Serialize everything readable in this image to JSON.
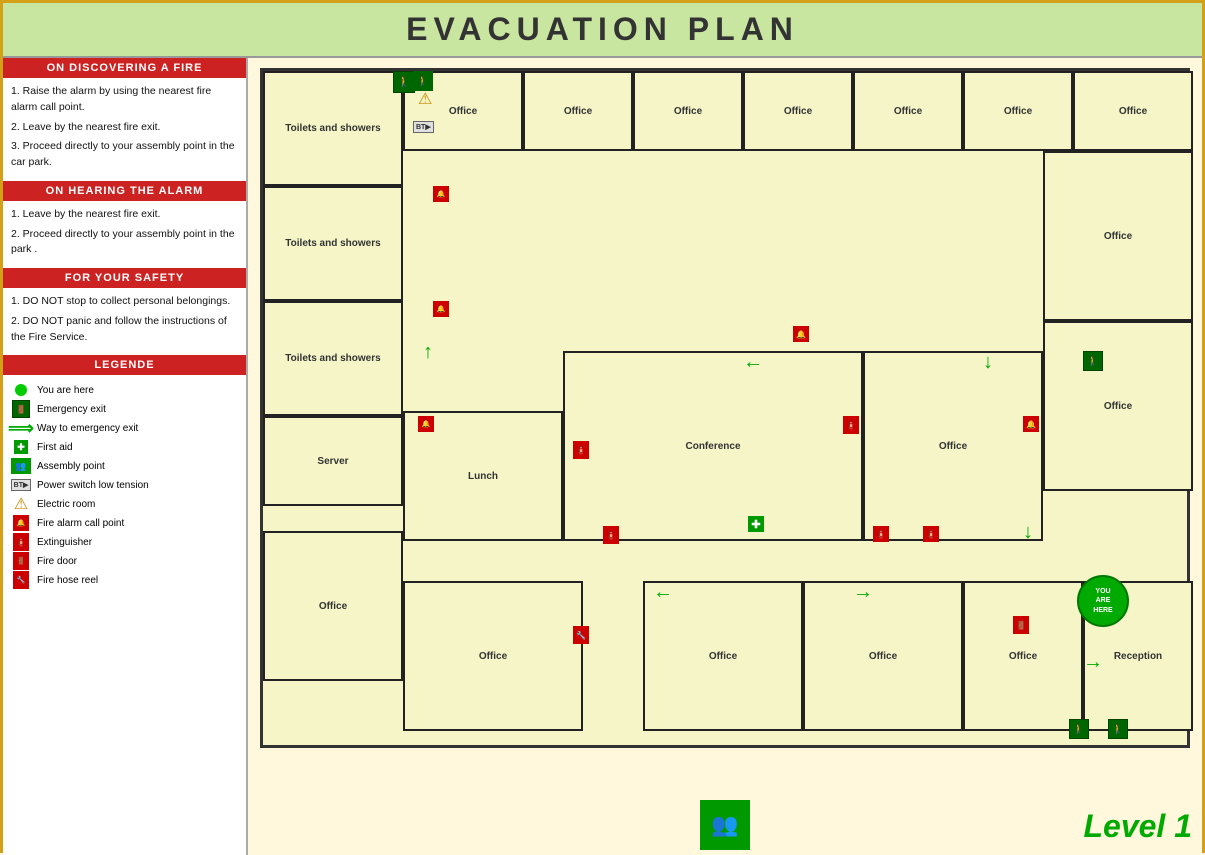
{
  "title": "EVACUATION PLAN",
  "left_panel": {
    "sections": [
      {
        "header": "ON DISCOVERING A FIRE",
        "items": [
          "1. Raise the alarm by using the nearest fire alarm call point.",
          "2. Leave by the nearest fire exit.",
          "3. Proceed directly to your assembly point in the car park."
        ]
      },
      {
        "header": "ON HEARING THE ALARM",
        "items": [
          "1. Leave by the nearest fire exit.",
          "2. Proceed directly to your assembly point in the park ."
        ]
      },
      {
        "header": "FOR YOUR SAFETY",
        "items": [
          "1. DO NOT stop to collect personal belongings.",
          "2. DO NOT panic and follow the instructions of the Fire Service."
        ]
      },
      {
        "header": "LEGENDE",
        "items": []
      }
    ],
    "legend": [
      {
        "icon": "green-dot",
        "label": "You are here"
      },
      {
        "icon": "exit-icon",
        "label": "Emergency exit"
      },
      {
        "icon": "arrow-icon",
        "label": "Way to emergency exit"
      },
      {
        "icon": "firstaid-icon",
        "label": "First aid"
      },
      {
        "icon": "assembly-icon",
        "label": "Assembly point"
      },
      {
        "icon": "bt-icon",
        "label": "Power switch low tension"
      },
      {
        "icon": "warning-icon",
        "label": "Electric room"
      },
      {
        "icon": "alarm-icon",
        "label": "Fire alarm call point"
      },
      {
        "icon": "extinguisher-icon",
        "label": "Extinguisher"
      },
      {
        "icon": "firedoor-icon",
        "label": "Fire door"
      },
      {
        "icon": "hose-icon",
        "label": "Fire hose reel"
      }
    ]
  },
  "rooms": [
    {
      "id": "toilets1",
      "label": "Toilets\nand\nshowers"
    },
    {
      "id": "toilets2",
      "label": "Toilets\nand\nshowers"
    },
    {
      "id": "toilets3",
      "label": "Toilets\nand\nshowers"
    },
    {
      "id": "server",
      "label": "Server"
    },
    {
      "id": "lunch",
      "label": "Lunch"
    },
    {
      "id": "conference",
      "label": "Conference"
    },
    {
      "id": "office1",
      "label": "Office"
    },
    {
      "id": "office2",
      "label": "Office"
    },
    {
      "id": "office3",
      "label": "Office"
    },
    {
      "id": "office4",
      "label": "Office"
    },
    {
      "id": "office5",
      "label": "Office"
    },
    {
      "id": "office6",
      "label": "Office"
    },
    {
      "id": "office7",
      "label": "Office"
    },
    {
      "id": "office8",
      "label": "Office"
    },
    {
      "id": "office9",
      "label": "Office"
    },
    {
      "id": "office10",
      "label": "Office"
    },
    {
      "id": "office11",
      "label": "Office"
    },
    {
      "id": "office12",
      "label": "Office"
    },
    {
      "id": "reception",
      "label": "Reception"
    }
  ],
  "level": "Level 1",
  "you_are_here": "YOU\nARE\nHERE"
}
